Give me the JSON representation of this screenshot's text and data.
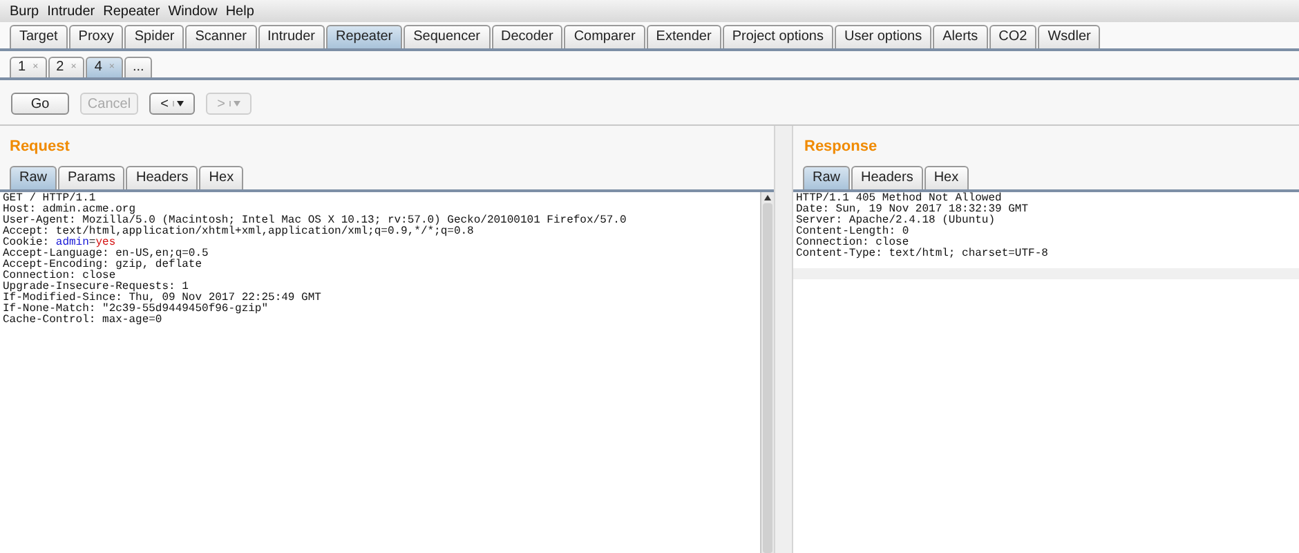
{
  "menu": [
    "Burp",
    "Intruder",
    "Repeater",
    "Window",
    "Help"
  ],
  "tabs": [
    {
      "label": "Target",
      "selected": false
    },
    {
      "label": "Proxy",
      "selected": false
    },
    {
      "label": "Spider",
      "selected": false
    },
    {
      "label": "Scanner",
      "selected": false
    },
    {
      "label": "Intruder",
      "selected": false
    },
    {
      "label": "Repeater",
      "selected": true
    },
    {
      "label": "Sequencer",
      "selected": false
    },
    {
      "label": "Decoder",
      "selected": false
    },
    {
      "label": "Comparer",
      "selected": false
    },
    {
      "label": "Extender",
      "selected": false
    },
    {
      "label": "Project options",
      "selected": false
    },
    {
      "label": "User options",
      "selected": false
    },
    {
      "label": "Alerts",
      "selected": false
    },
    {
      "label": "CO2",
      "selected": false
    },
    {
      "label": "Wsdler",
      "selected": false
    }
  ],
  "repeater_tabs": [
    {
      "label": "1",
      "close": "×",
      "selected": false
    },
    {
      "label": "2",
      "close": "×",
      "selected": false
    },
    {
      "label": "4",
      "close": "×",
      "selected": true
    }
  ],
  "more_tab": "...",
  "toolbar": {
    "go": {
      "label": "Go",
      "disabled": false
    },
    "cancel": {
      "label": "Cancel",
      "disabled": true
    },
    "back": {
      "label": "<",
      "disabled": false
    },
    "forward": {
      "label": ">",
      "disabled": true
    }
  },
  "request": {
    "title": "Request",
    "tabs": [
      {
        "label": "Raw",
        "selected": true
      },
      {
        "label": "Params",
        "selected": false
      },
      {
        "label": "Headers",
        "selected": false
      },
      {
        "label": "Hex",
        "selected": false
      }
    ],
    "lines": [
      {
        "kind": "text",
        "text": "GET / HTTP/1.1"
      },
      {
        "kind": "text",
        "text": "Host: admin.acme.org"
      },
      {
        "kind": "text",
        "text": "User-Agent: Mozilla/5.0 (Macintosh; Intel Mac OS X 10.13; rv:57.0) Gecko/20100101 Firefox/57.0"
      },
      {
        "kind": "text",
        "text": "Accept: text/html,application/xhtml+xml,application/xml;q=0.9,*/*;q=0.8"
      },
      {
        "kind": "cookie",
        "prefix": "Cookie: ",
        "name": "admin",
        "sep": "=",
        "value": "yes"
      },
      {
        "kind": "text",
        "text": "Accept-Language: en-US,en;q=0.5"
      },
      {
        "kind": "text",
        "text": "Accept-Encoding: gzip, deflate"
      },
      {
        "kind": "text",
        "text": "Connection: close"
      },
      {
        "kind": "text",
        "text": "Upgrade-Insecure-Requests: 1"
      },
      {
        "kind": "text",
        "text": "If-Modified-Since: Thu, 09 Nov 2017 22:25:49 GMT"
      },
      {
        "kind": "text",
        "text": "If-None-Match: \"2c39-55d9449450f96-gzip\""
      },
      {
        "kind": "text",
        "text": "Cache-Control: max-age=0"
      }
    ]
  },
  "response": {
    "title": "Response",
    "tabs": [
      {
        "label": "Raw",
        "selected": true
      },
      {
        "label": "Headers",
        "selected": false
      },
      {
        "label": "Hex",
        "selected": false
      }
    ],
    "lines": [
      "HTTP/1.1 405 Method Not Allowed",
      "Date: Sun, 19 Nov 2017 18:32:39 GMT",
      "Server: Apache/2.4.18 (Ubuntu)",
      "Content-Length: 0",
      "Connection: close",
      "Content-Type: text/html; charset=UTF-8"
    ]
  }
}
